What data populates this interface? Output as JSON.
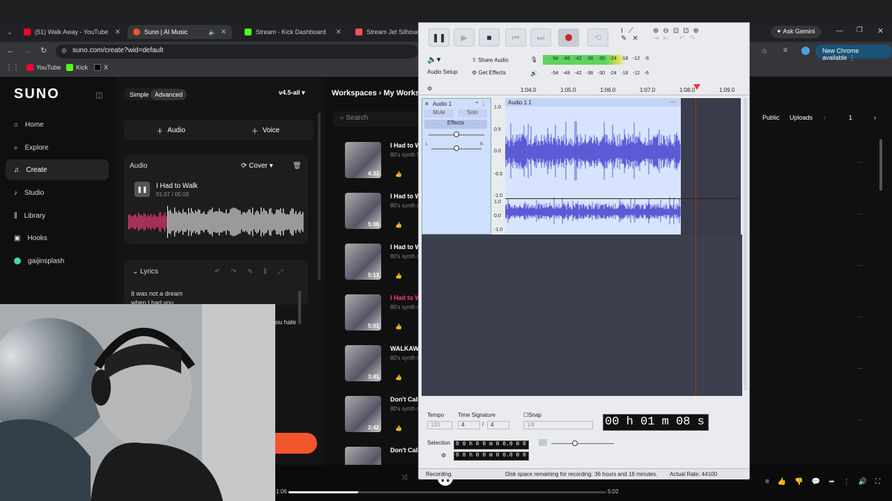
{
  "browser": {
    "tabs": [
      {
        "label": "(51) Walk Away - YouTube",
        "color": "#ff0033"
      },
      {
        "label": "Suno | AI Music",
        "color": "#f2552c"
      },
      {
        "label": "Stream - Kick Dashboard",
        "color": "#53fc18"
      },
      {
        "label": "Stream Jet Silhouette",
        "color": "#e55"
      }
    ],
    "url": "suno.com/create?wid=default",
    "bookmarks": [
      "YouTube",
      "Kick",
      "X"
    ],
    "ask_gemini": "Ask Gemini",
    "chrome_update": "New Chrome available"
  },
  "suno": {
    "logo": "SUNO",
    "nav": [
      "Home",
      "Explore",
      "Create",
      "Studio",
      "Library",
      "Hooks",
      "gaijinsplash"
    ],
    "mode_simple": "Simple",
    "mode_advanced": "Advanced",
    "model": "v4.5-all",
    "add_audio": "Audio",
    "add_voice": "Voice",
    "audio_label": "Audio",
    "cover_label": "Cover",
    "track_title": "I Had to Walk",
    "track_time": "01:07 / 05:03",
    "lyrics_label": "Lyrics",
    "lyrics_line1": "It was not a dream",
    "lyrics_line2": "when I had you",
    "lyrics_frag1": "ou hate",
    "workspace_crumb": "Workspaces",
    "workspace_name": "My Worksp",
    "search_placeholder": "Search",
    "songs": [
      {
        "title": "I Had to W",
        "sub": "80's synth S",
        "dur": "4:33"
      },
      {
        "title": "I Had to W",
        "sub": "80's synth s",
        "dur": "5:08"
      },
      {
        "title": "I Had to W",
        "sub": "80's synth s",
        "dur": "5:13"
      },
      {
        "title": "I Had to W",
        "sub": "80's synth s",
        "dur": "5:03"
      },
      {
        "title": "WALKAW",
        "sub": "80's synth c",
        "dur": "3:41"
      },
      {
        "title": "Don't Call",
        "sub": "80's synth s",
        "dur": "2:42"
      },
      {
        "title": "Don't Call",
        "sub": "",
        "dur": ""
      }
    ],
    "filter_public": "Public",
    "filter_uploads": "Uploads",
    "page": "1",
    "player_elapsed": "1:06",
    "player_total": "5:02"
  },
  "audacity": {
    "audio_setup": "Audio Setup",
    "share_audio": "Share Audio",
    "get_effects": "Get Effects",
    "meter_ticks": [
      "-54",
      "-48",
      "-42",
      "-36",
      "-30",
      "-24",
      "-18",
      "-12",
      "-6"
    ],
    "timeline": [
      "1:04.0",
      "1:05.0",
      "1:06.0",
      "1:07.0",
      "1:08.0",
      "1:09.0"
    ],
    "track_name": "Audio 1",
    "clip_name": "Audio 1.1",
    "mute": "Mute",
    "solo": "Solo",
    "effects": "Effects",
    "y_top": [
      "1.0",
      "0.5",
      "0.0",
      "-0.5",
      "-1.0"
    ],
    "y_bot": [
      "1.0",
      "0.0",
      "-1.0"
    ],
    "tempo_label": "Tempo",
    "tempo_value": "120",
    "time_sig_label": "Time Signature",
    "ts_num": "4",
    "ts_den": "4",
    "snap_label": "Snap",
    "snap_value": "1/8",
    "big_time": "00 h 01 m 08 s",
    "selection_label": "Selection",
    "sel_start": "0 0 h 0 0 m 0 0.0 0 0 s",
    "sel_end": "0 0 h 0 0 m 0 0.0 0 0 s",
    "status_left": "Recording.",
    "status_mid": "Disk space remaining for recording: 36 hours and 19 minutes.",
    "status_right": "Actual Rate: 44100"
  },
  "colors": {
    "accent": "#ff3d7f",
    "wave": "#5b5bd6",
    "suno_orange": "#f2552c"
  }
}
